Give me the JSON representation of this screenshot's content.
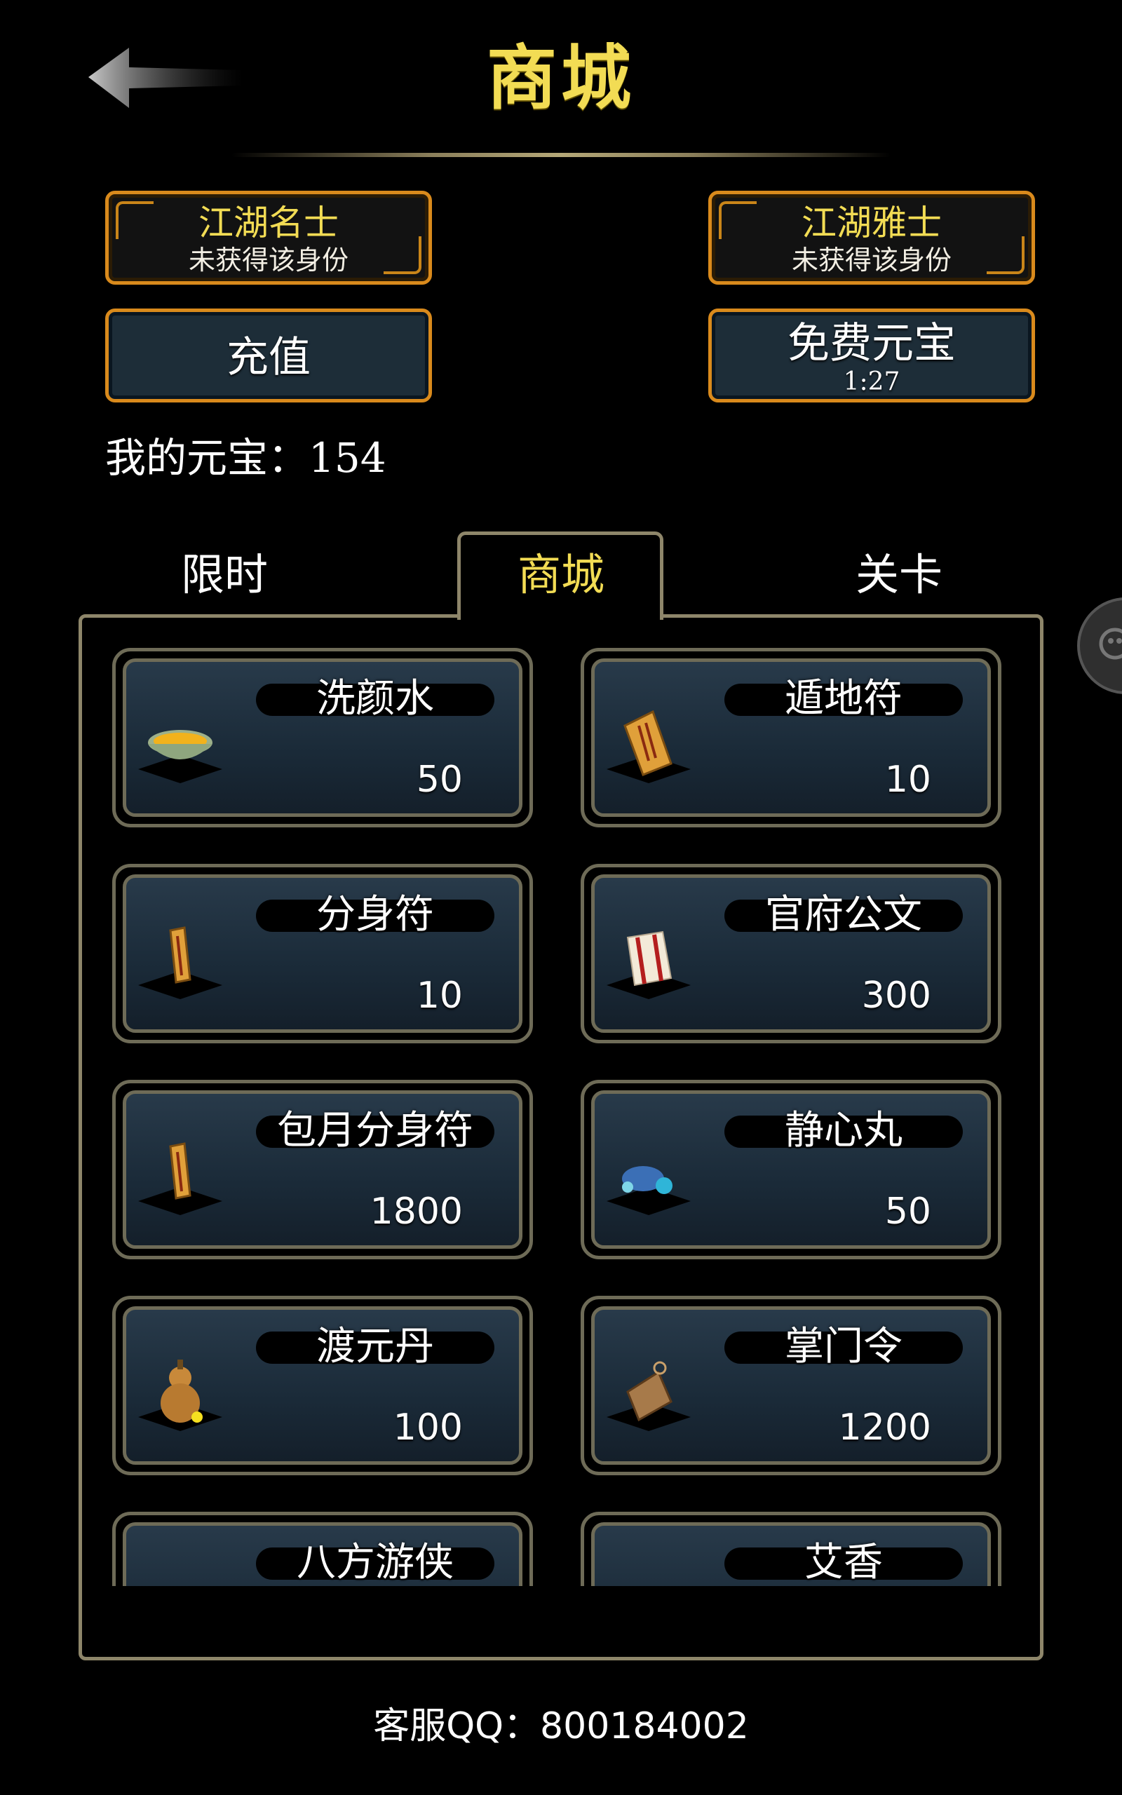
{
  "header": {
    "title": "商城",
    "back_icon": "back-arrow-icon"
  },
  "status_cards": [
    {
      "title": "江湖名士",
      "subtitle": "未获得该身份"
    },
    {
      "title": "江湖雅士",
      "subtitle": "未获得该身份"
    }
  ],
  "actions": {
    "recharge_label": "充值",
    "free_ingots_label": "免费元宝",
    "free_ingots_timer": "1:27"
  },
  "balance": {
    "text": "我的元宝：154"
  },
  "tabs": [
    {
      "label": "限时",
      "active": false
    },
    {
      "label": "商城",
      "active": true
    },
    {
      "label": "关卡",
      "active": false
    }
  ],
  "items": [
    {
      "name": "洗颜水",
      "price": "50",
      "icon": "bowl-icon"
    },
    {
      "name": "遁地符",
      "price": "10",
      "icon": "talisman-icon"
    },
    {
      "name": "分身符",
      "price": "10",
      "icon": "talisman-icon"
    },
    {
      "name": "官府公文",
      "price": "300",
      "icon": "document-icon"
    },
    {
      "name": "包月分身符",
      "price": "1800",
      "icon": "talisman-icon"
    },
    {
      "name": "静心丸",
      "price": "50",
      "icon": "pill-icon"
    },
    {
      "name": "渡元丹",
      "price": "100",
      "icon": "gourd-icon"
    },
    {
      "name": "掌门令",
      "price": "1200",
      "icon": "token-icon"
    },
    {
      "name": "八方游侠",
      "price": "",
      "icon": "flower-icon"
    },
    {
      "name": "艾香",
      "price": "",
      "icon": "incense-icon"
    }
  ],
  "footer": {
    "support_text": "客服QQ：800184002"
  },
  "colors": {
    "gold": "#f2dc54",
    "orange_border": "#d98a1c",
    "panel_border": "#8e866a",
    "card_bg": "#1d2d38"
  }
}
